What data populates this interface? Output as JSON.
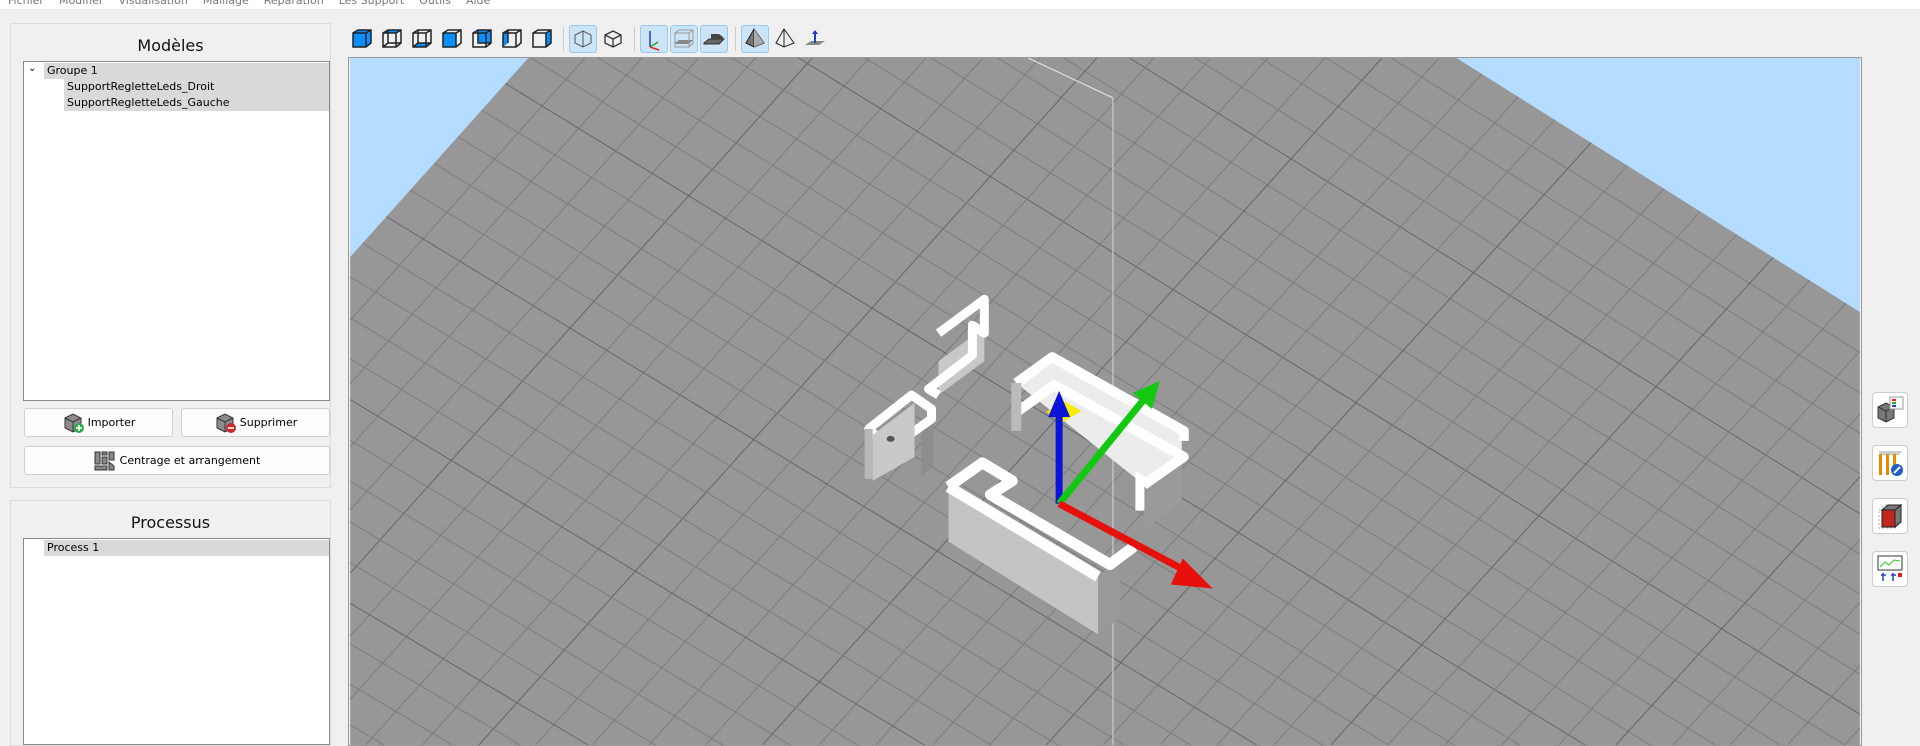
{
  "menu": [
    "Fichier",
    "Modifier",
    "Visualisation",
    "Maillage",
    "Réparation",
    "Les Support",
    "Outils",
    "Aide"
  ],
  "models_panel": {
    "title": "Modèles",
    "group": "Groupe 1",
    "items": [
      "SupportRegletteLeds_Droit",
      "SupportRegletteLeds_Gauche"
    ],
    "import_label": "Importer",
    "delete_label": "Supprimer",
    "arrange_label": "Centrage et arrangement"
  },
  "process_panel": {
    "title": "Processus",
    "items": [
      "Process 1"
    ]
  },
  "toolbar": {
    "icons": [
      "view-iso-icon",
      "view-top-icon",
      "view-bottom-icon",
      "view-front-icon",
      "view-back-icon",
      "view-left-icon",
      "view-right-icon",
      "perspective-icon",
      "orthographic-icon",
      "axes-icon",
      "build-volume-icon",
      "plate-icon",
      "solid-shading-icon",
      "wireframe-icon",
      "gizmo-icon"
    ]
  },
  "colors": {
    "accent": "#0b8fff",
    "sky": "#b3dcff",
    "plate": "#979797",
    "grid": "#7c7c7c",
    "x_axis": "#e8100a",
    "y_axis": "#13c813",
    "z_axis": "#0a13d6"
  }
}
